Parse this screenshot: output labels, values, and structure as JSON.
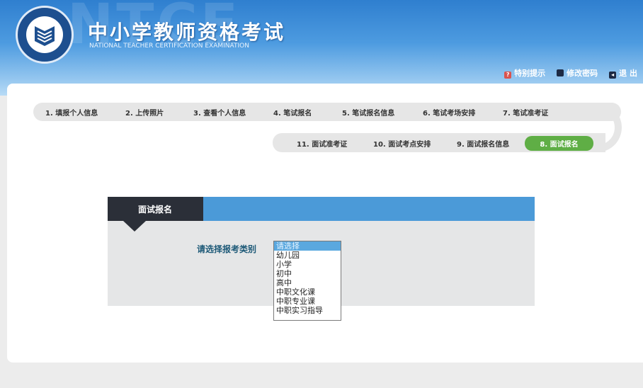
{
  "header": {
    "watermark": "NTCE",
    "title": "中小学教师资格考试",
    "subtitle": "NATIONAL TEACHER CERTIFICATION EXAMINATION",
    "links": [
      {
        "label": "特别提示",
        "icon": "help-icon"
      },
      {
        "label": "修改密码",
        "icon": "key-icon"
      },
      {
        "label": "退 出",
        "icon": "logout-icon"
      }
    ]
  },
  "steps_row1": [
    "1. 填报个人信息",
    "2. 上传照片",
    "3. 查看个人信息",
    "4. 笔试报名",
    "5. 笔试报名信息",
    "6. 笔试考场安排",
    "7. 笔试准考证"
  ],
  "steps_row2": [
    "11. 面试准考证",
    "10. 面试考点安排",
    "9. 面试报名信息",
    "8. 面试报名"
  ],
  "active_step": "8. 面试报名",
  "form": {
    "tab": "面试报名",
    "label": "请选择报考类别",
    "options": [
      "请选择",
      "幼儿园",
      "小学",
      "初中",
      "高中",
      "中职文化课",
      "中职专业课",
      "中职实习指导"
    ],
    "selected": "请选择"
  },
  "colors": {
    "accent": "#4b9ad8",
    "active": "#5fae45",
    "dark": "#2b2f38"
  }
}
